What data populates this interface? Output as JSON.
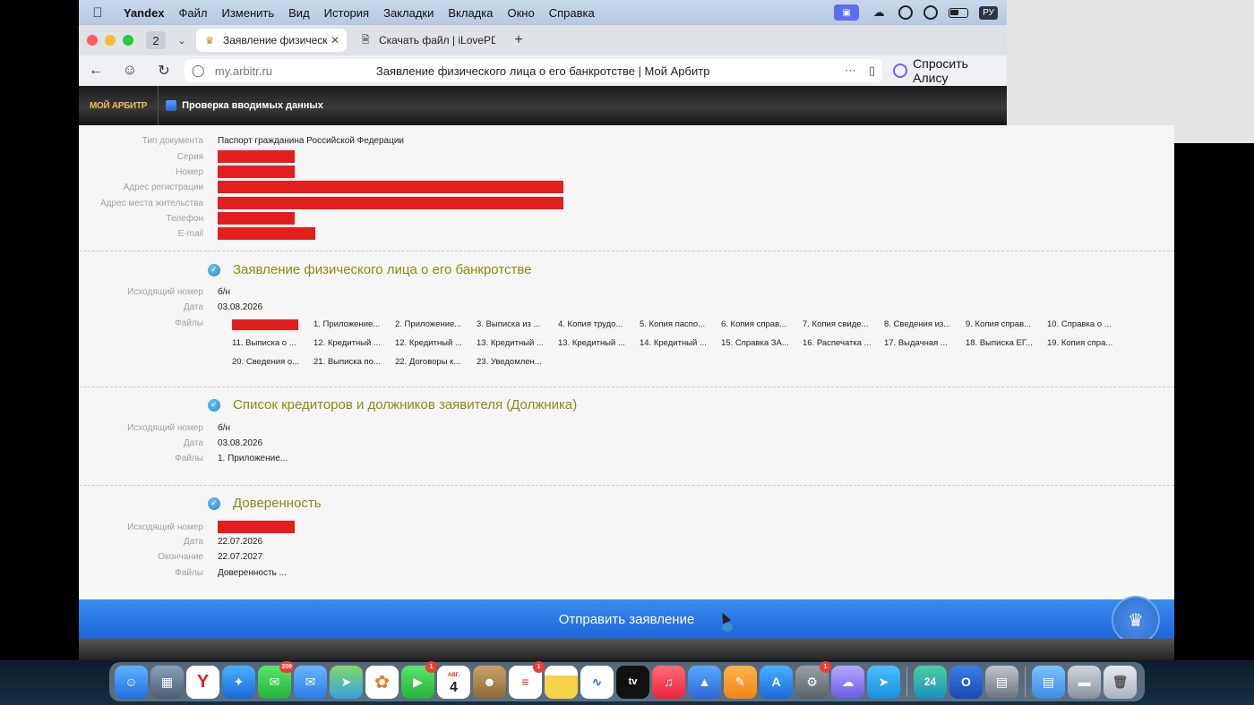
{
  "menubar": {
    "app": "Yandex",
    "items": [
      "Файл",
      "Изменить",
      "Вид",
      "История",
      "Закладки",
      "Вкладка",
      "Окно",
      "Справка"
    ],
    "lang": "РУ"
  },
  "browser": {
    "tab_count": "2",
    "tabs": [
      {
        "label": "Заявление физическо",
        "active": true
      },
      {
        "label": "Скачать файл | iLovePDF",
        "active": false
      }
    ],
    "url": "my.arbitr.ru",
    "page_title": "Заявление физического лица о его банкротстве | Мой Арбитр",
    "alice": "Спросить Алису"
  },
  "site": {
    "logo_text": "МОЙ АРБИТР",
    "breadcrumb": "Проверка вводимых данных"
  },
  "identity": {
    "doc_type_label": "Тип документа",
    "doc_type_value": "Паспорт гражданина Российской Федерации",
    "series_label": "Серия",
    "number_label": "Номер",
    "reg_address_label": "Адрес регистрации",
    "live_address_label": "Адрес места жительства",
    "phone_label": "Телефон",
    "email_label": "E-mail"
  },
  "labels": {
    "out_number": "Исходящий номер",
    "date": "Дата",
    "files": "Файлы",
    "expiry": "Окончание"
  },
  "sections": [
    {
      "title": "Заявление физического лица о его банкротстве",
      "out_number": "б/н",
      "date": "03.08.2026",
      "files": [
        "1. Приложение...",
        "2. Приложение...",
        "3. Выписка из ...",
        "4. Копия трудо...",
        "5. Копия паспо...",
        "6. Копия справ...",
        "7. Копия свиде...",
        "8. Сведения из...",
        "9. Копия справ...",
        "10. Справка о ...",
        "11. Выписка о ...",
        "12. Кредитный ...",
        "12. Кредитный ...",
        "13. Кредитный ...",
        "13. Кредитный ...",
        "14. Кредитный ...",
        "15. Справка ЗА...",
        "16. Распечатка ...",
        "17. Выдачная ...",
        "18. Выписка ЕГ...",
        "19. Копия спра...",
        "20. Сведения о...",
        "21. Выписка по...",
        "22. Договоры к...",
        "23. Уведомлен..."
      ]
    },
    {
      "title": "Список кредиторов и должников заявителя (Должника)",
      "out_number": "б/н",
      "date": "03.08.2026",
      "files": [
        "1. Приложение..."
      ]
    },
    {
      "title": "Доверенность",
      "date": "22.07.2026",
      "expiry": "22.07.2027",
      "files": [
        "Доверенность ..."
      ]
    }
  ],
  "submit_label": "Отправить заявление",
  "dock": {
    "badges": {
      "messages": "209",
      "facetime": "1",
      "reminders": "1",
      "settings": "1"
    },
    "calendar_month": "АВГ.",
    "calendar_day": "4"
  }
}
